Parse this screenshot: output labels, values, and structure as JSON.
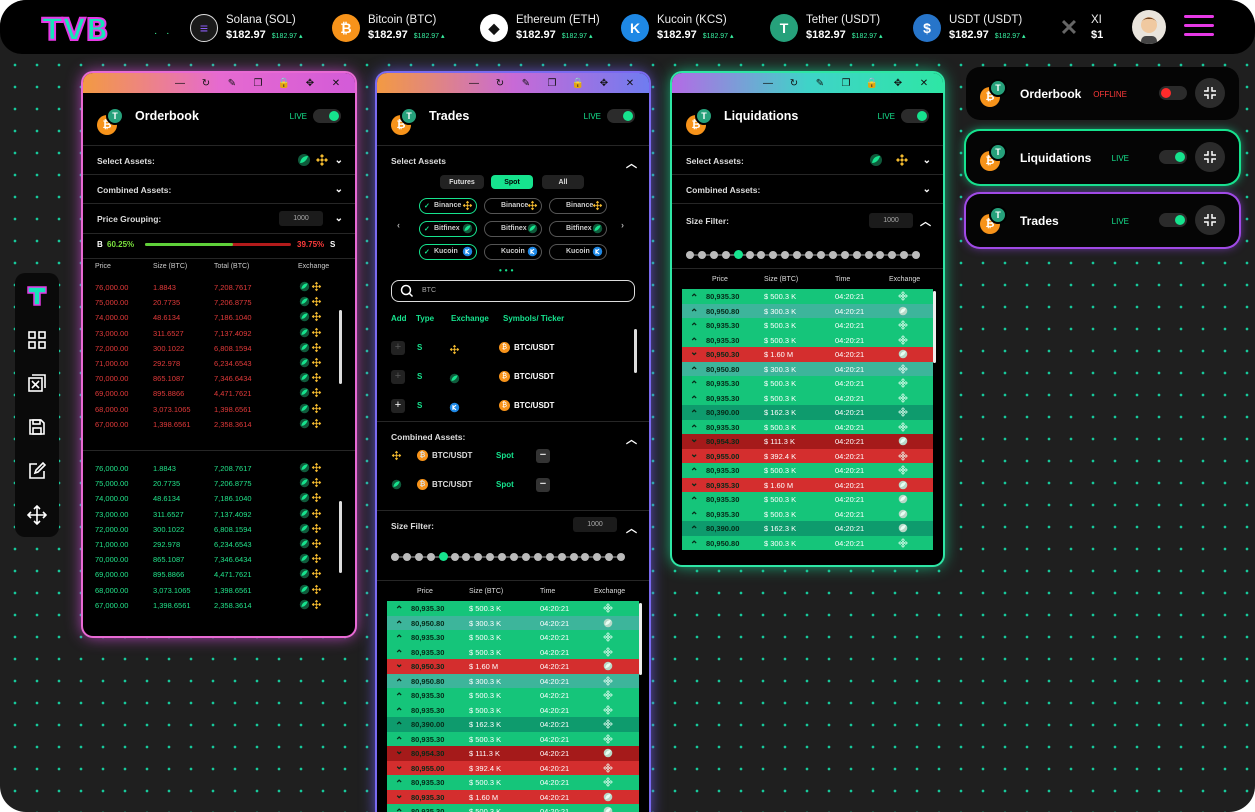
{
  "brand": {
    "logo": "TVB"
  },
  "tickers": [
    {
      "name": "Solana (SOL)",
      "price": "$182.97",
      "change": "$182.97",
      "icon": "solana-icon",
      "color": "#1a1a1a"
    },
    {
      "name": "Bitcoin (BTC)",
      "price": "$182.97",
      "change": "$182.97",
      "icon": "bitcoin-icon",
      "color": "#f7931a"
    },
    {
      "name": "Ethereum (ETH)",
      "price": "$182.97",
      "change": "$182.97",
      "icon": "ethereum-icon",
      "color": "#ffffff"
    },
    {
      "name": "Kucoin (KCS)",
      "price": "$182.97",
      "change": "$182.97",
      "icon": "kucoin-icon",
      "color": "#1e88e5"
    },
    {
      "name": "Tether (USDT)",
      "price": "$182.97",
      "change": "$182.97",
      "icon": "tether-icon",
      "color": "#26a17b"
    },
    {
      "name": "USDT (USDT)",
      "price": "$182.97",
      "change": "$182.97",
      "icon": "usdc-icon",
      "color": "#2775ca"
    },
    {
      "name": "XI",
      "price": "$1",
      "change": "",
      "icon": "x-icon",
      "color": "#333"
    }
  ],
  "colors": {
    "green": "#16e38e",
    "red": "#e23a3a",
    "accentPink": "#e639e6",
    "binance": "#f3ba2f"
  },
  "orderbook": {
    "title": "Orderbook",
    "live": "LIVE",
    "select_assets": "Select Assets:",
    "combined_assets": "Combined Assets:",
    "price_grouping": "Price Grouping:",
    "grouping_value": "1000",
    "buy_label": "B",
    "buy_pct": "60.25%",
    "sell_pct": "39.75%",
    "sell_label": "S",
    "buy_ratio": 0.6025,
    "headers": [
      "Price",
      "Size (BTC)",
      "Total (BTC)",
      "Exchange"
    ],
    "asks": [
      [
        "76,000.00",
        "1.8843",
        "7,208.7617"
      ],
      [
        "75,000.00",
        "20.7735",
        "7,206.8775"
      ],
      [
        "74,000.00",
        "48.6134",
        "7,186.1040"
      ],
      [
        "73,000.00",
        "311.6527",
        "7,137.4092"
      ],
      [
        "72,000.00",
        "300.1022",
        "6,808.1594"
      ],
      [
        "71,000.00",
        "292.978",
        "6,234.6543"
      ],
      [
        "70,000.00",
        "865.1087",
        "7,346.6434"
      ],
      [
        "69,000.00",
        "895.8866",
        "4,471.7621"
      ],
      [
        "68,000.00",
        "3,073.1065",
        "1,398.6561"
      ],
      [
        "67,000.00",
        "1,398.6561",
        "2,358.3614"
      ]
    ],
    "bids": [
      [
        "76,000.00",
        "1.8843",
        "7,208.7617"
      ],
      [
        "75,000.00",
        "20.7735",
        "7,206.8775"
      ],
      [
        "74,000.00",
        "48.6134",
        "7,186.1040"
      ],
      [
        "73,000.00",
        "311.6527",
        "7,137.4092"
      ],
      [
        "72,000.00",
        "300.1022",
        "6,808.1594"
      ],
      [
        "71,000.00",
        "292.978",
        "6,234.6543"
      ],
      [
        "70,000.00",
        "865.1087",
        "7,346.6434"
      ],
      [
        "69,000.00",
        "895.8866",
        "4,471.7621"
      ],
      [
        "68,000.00",
        "3,073.1065",
        "1,398.6561"
      ],
      [
        "67,000.00",
        "1,398.6561",
        "2,358.3614"
      ]
    ]
  },
  "trades": {
    "title": "Trades",
    "live": "LIVE",
    "select_assets": "Select Assets",
    "market_tabs": [
      "Futures",
      "Spot",
      "All"
    ],
    "active_tab": "Spot",
    "exchanges": [
      [
        "Binance",
        "Binance",
        "Binance"
      ],
      [
        "Bitfinex",
        "Bitfinex",
        "Bitfinex"
      ],
      [
        "Kucoin",
        "Kucoin",
        "Kucoin"
      ]
    ],
    "search": "BTC",
    "list_headers": [
      "Add",
      "Type",
      "Exchange",
      "Symbols/ Ticker"
    ],
    "assets": [
      {
        "type": "S",
        "exchange": "binance",
        "symbol": "BTC/USDT"
      },
      {
        "type": "S",
        "exchange": "bitfinex",
        "symbol": "BTC/USDT"
      },
      {
        "type": "S",
        "exchange": "kucoin",
        "symbol": "BTC/USDT"
      }
    ],
    "combined_label": "Combined Assets:",
    "combined": [
      {
        "symbol": "BTC/USDT",
        "market": "Spot",
        "exchange": "binance"
      },
      {
        "symbol": "BTC/USDT",
        "market": "Spot",
        "exchange": "bitfinex"
      }
    ],
    "size_filter": "Size Filter:",
    "size_value": "1000",
    "table_headers": [
      "Price",
      "Size (BTC)",
      "Time",
      "Exchange"
    ]
  },
  "liquidations": {
    "title": "Liquidations",
    "live": "LIVE",
    "select_assets": "Select Assets:",
    "combined_assets": "Combined Assets:",
    "size_filter": "Size Filter:",
    "size_value": "1000",
    "table_headers": [
      "Price",
      "Size (BTC)",
      "Time",
      "Exchange"
    ]
  },
  "trade_rows": [
    {
      "side": "up",
      "price": "80,935.30",
      "size": "$ 500.3 K",
      "time": "04:20:21",
      "ex": "binance",
      "shade": "g1"
    },
    {
      "side": "up",
      "price": "80,950.80",
      "size": "$ 300.3 K",
      "time": "04:20:21",
      "ex": "bitfinex",
      "shade": "g2"
    },
    {
      "side": "up",
      "price": "80,935.30",
      "size": "$ 500.3 K",
      "time": "04:20:21",
      "ex": "binance",
      "shade": "g1"
    },
    {
      "side": "up",
      "price": "80,935.30",
      "size": "$ 500.3 K",
      "time": "04:20:21",
      "ex": "binance",
      "shade": "g1"
    },
    {
      "side": "down",
      "price": "80,950.30",
      "size": "$ 1.60 M",
      "time": "04:20:21",
      "ex": "bitfinex",
      "shade": "r1"
    },
    {
      "side": "up",
      "price": "80,950.80",
      "size": "$ 300.3 K",
      "time": "04:20:21",
      "ex": "binance",
      "shade": "g2"
    },
    {
      "side": "up",
      "price": "80,935.30",
      "size": "$ 500.3 K",
      "time": "04:20:21",
      "ex": "binance",
      "shade": "g1"
    },
    {
      "side": "up",
      "price": "80,935.30",
      "size": "$ 500.3 K",
      "time": "04:20:21",
      "ex": "binance",
      "shade": "g1"
    },
    {
      "side": "up",
      "price": "80,390.00",
      "size": "$ 162.3 K",
      "time": "04:20:21",
      "ex": "binance",
      "shade": "g3"
    },
    {
      "side": "up",
      "price": "80,935.30",
      "size": "$ 500.3 K",
      "time": "04:20:21",
      "ex": "binance",
      "shade": "g1"
    },
    {
      "side": "down",
      "price": "80,954.30",
      "size": "$ 111.3 K",
      "time": "04:20:21",
      "ex": "bitfinex",
      "shade": "r2"
    },
    {
      "side": "down",
      "price": "80,955.00",
      "size": "$ 392.4 K",
      "time": "04:20:21",
      "ex": "binance",
      "shade": "r1"
    },
    {
      "side": "up",
      "price": "80,935.30",
      "size": "$ 500.3 K",
      "time": "04:20:21",
      "ex": "binance",
      "shade": "g1"
    },
    {
      "side": "down",
      "price": "80,935.30",
      "size": "$ 1.60 M",
      "time": "04:20:21",
      "ex": "bitfinex",
      "shade": "r1"
    },
    {
      "side": "up",
      "price": "80,935.30",
      "size": "$ 500.3 K",
      "time": "04:20:21",
      "ex": "bitfinex",
      "shade": "g1"
    },
    {
      "side": "up",
      "price": "80,935.30",
      "size": "$ 500.3 K",
      "time": "04:20:21",
      "ex": "bitfinex",
      "shade": "g1"
    },
    {
      "side": "up",
      "price": "80,390.00",
      "size": "$ 162.3 K",
      "time": "04:20:21",
      "ex": "bitfinex",
      "shade": "g3"
    },
    {
      "side": "up",
      "price": "80,950.80",
      "size": "$ 300.3 K",
      "time": "04:20:21",
      "ex": "binance",
      "shade": "g1"
    }
  ],
  "widgets": [
    {
      "title": "Orderbook",
      "status": "OFFLINE",
      "on": false
    },
    {
      "title": "Liquidations",
      "status": "LIVE",
      "on": true
    },
    {
      "title": "Trades",
      "status": "LIVE",
      "on": true
    }
  ]
}
